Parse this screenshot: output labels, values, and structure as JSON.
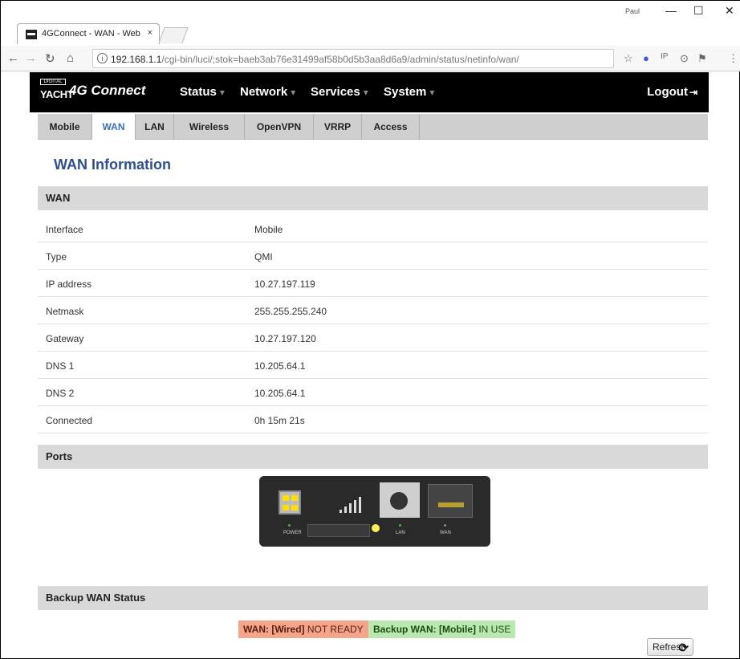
{
  "browser": {
    "tab_title": "4GConnect - WAN - Web",
    "tab_close": "×",
    "user": "Paul",
    "url_main": "192.168.1.1",
    "url_path": "/cgi-bin/luci/;stok=baeb3ab76e31499af58b0d5b3aa8d6a9/admin/status/netinfo/wan/",
    "minimize": "—",
    "maximize": "☐",
    "close": "✕"
  },
  "header": {
    "logo_top": "DIGITAL",
    "logo_bottom": "YACHT",
    "brand": "4G Connect",
    "menus": [
      "Status",
      "Network",
      "Services",
      "System"
    ],
    "logout": "Logout"
  },
  "subtabs": [
    "Mobile",
    "WAN",
    "LAN",
    "Wireless",
    "OpenVPN",
    "VRRP",
    "Access"
  ],
  "active_subtab": "WAN",
  "page_title": "WAN Information",
  "wan_section": {
    "title": "WAN",
    "rows": [
      {
        "key": "Interface",
        "value": "Mobile"
      },
      {
        "key": "Type",
        "value": "QMI"
      },
      {
        "key": "IP address",
        "value": "10.27.197.119"
      },
      {
        "key": "Netmask",
        "value": "255.255.255.240"
      },
      {
        "key": "Gateway",
        "value": "10.27.197.120"
      },
      {
        "key": "DNS 1",
        "value": "10.205.64.1"
      },
      {
        "key": "DNS 2",
        "value": "10.205.64.1"
      },
      {
        "key": "Connected",
        "value": "0h 15m 21s"
      }
    ]
  },
  "ports_section": {
    "title": "Ports",
    "labels": {
      "power": "POWER",
      "lan": "LAN",
      "wan": "WAN"
    }
  },
  "backup_section": {
    "title": "Backup WAN Status",
    "wan_label": "WAN: [Wired]",
    "wan_state": "NOT READY",
    "backup_label": "Backup WAN: [Mobile]",
    "backup_state": "IN USE",
    "refresh": "Refresh"
  },
  "colors": {
    "header_bg": "#000000",
    "accent": "#3a70b8",
    "title": "#2f4f8f",
    "not_ready_bg": "#f5a58a",
    "in_use_bg": "#b9e8b1"
  }
}
